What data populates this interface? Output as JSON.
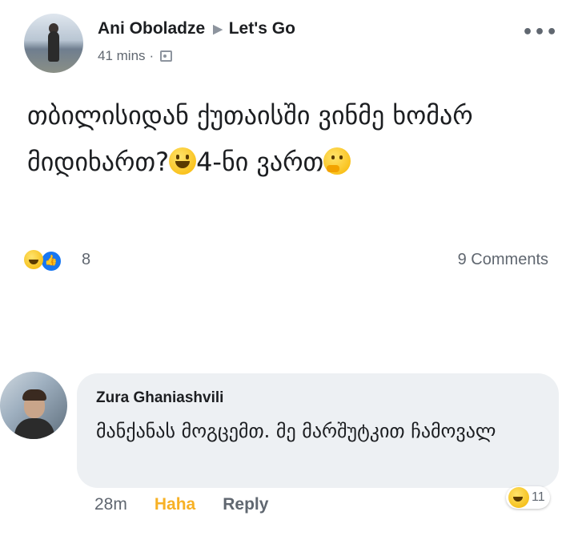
{
  "post": {
    "author": "Ani Oboladze",
    "arrow": "▶",
    "group": "Let's Go",
    "time": "41 mins",
    "separator": "·",
    "audience_icon": "audience-icon",
    "more_icon": "•••",
    "text_part1": "თბილისიდან ქუთაისში ვინმე ხომარ მიდიხართ?",
    "text_part2": "4-ნი ვართ",
    "emoji_1": "grinning-face",
    "emoji_2": "thinking-face",
    "reaction_count": "8",
    "comments_count": "9 Comments"
  },
  "comment": {
    "author": "Zura Ghaniashvili",
    "text": "მანქანას მოგცემთ. მე მარშუტკით ჩამოვალ",
    "time": "28m",
    "reaction_label": "Haha",
    "reply_label": "Reply",
    "reaction_count": "11"
  },
  "colors": {
    "haha": "#f7b125",
    "like": "#1877f2",
    "bubble": "#edf0f3",
    "meta": "#606770"
  }
}
